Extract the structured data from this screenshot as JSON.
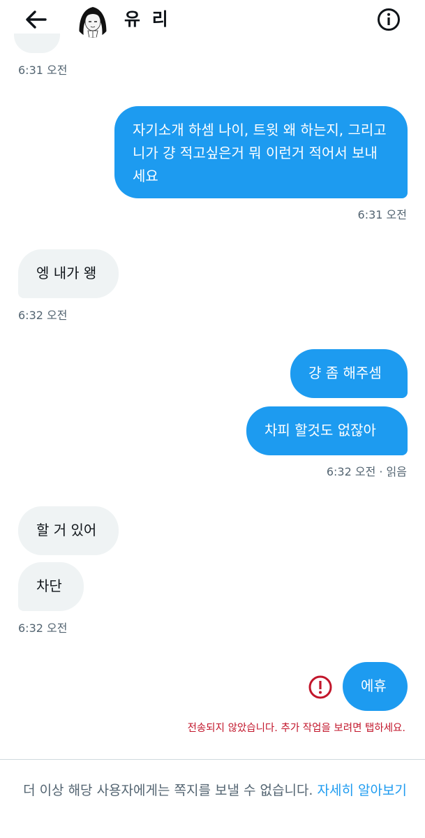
{
  "header": {
    "name": "유 리",
    "back_icon": "arrow-left-icon",
    "info_icon": "info-icon"
  },
  "messages": {
    "t0": "6:31 오전",
    "m1": "자기소개 하셈 나이, 트윗 왜 하는지, 그리고 니가 걍 적고싶은거 뭐 이런거 적어서 보내세요",
    "t1": "6:31 오전",
    "m2": "엥 내가 왱",
    "t2": "6:32 오전",
    "m3": "걍 좀 해주셈",
    "m4": "차피 할것도 없잖아",
    "t3": "6:32 오전 · 읽음",
    "m5": "할 거 있어",
    "m6": "차단",
    "t4": "6:32 오전",
    "m7": "에휴",
    "error": "전송되지 않았습니다. 추가 작업을 보려면 탭하세요."
  },
  "footer": {
    "notice": "더 이상 해당 사용자에게는 쪽지를 보낼 수 없습니다.",
    "link": "자세히 알아보기"
  },
  "colors": {
    "accent": "#1d9bf0",
    "error": "#c2162b",
    "incoming_bg": "#eff3f4",
    "muted": "#536471"
  }
}
